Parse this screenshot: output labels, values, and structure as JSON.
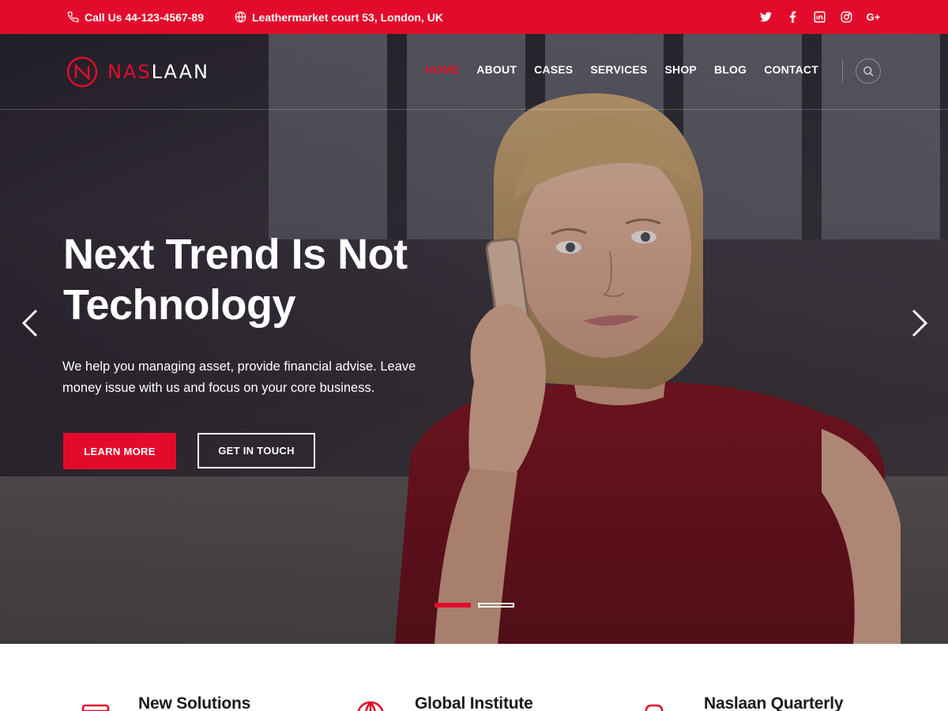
{
  "topbar": {
    "phone": "Call Us 44-123-4567-89",
    "address": "Leathermarket court 53, London, UK",
    "socials": [
      "twitter-icon",
      "facebook-icon",
      "linkedin-icon",
      "instagram-icon",
      "google-plus-icon"
    ],
    "gplus_label": "G+"
  },
  "header": {
    "logo_part1": "NAS",
    "logo_part2": "LAAN",
    "nav": [
      "HOME",
      "ABOUT",
      "CASES",
      "SERVICES",
      "SHOP",
      "BLOG",
      "CONTACT"
    ],
    "active_nav": "HOME"
  },
  "hero": {
    "headline_line1": "Next Trend Is Not",
    "headline_line2": "Technology",
    "subtext": "We help you managing asset, provide financial advise. Leave money issue with us and focus on your core business.",
    "primary_button": "LEARN MORE",
    "secondary_button": "GET IN TOUCH",
    "slides": 2,
    "active_slide": 1
  },
  "features": [
    {
      "title": "New Solutions",
      "icon": "card-icon"
    },
    {
      "title": "Global Institute",
      "icon": "globe-icon"
    },
    {
      "title": "Naslaan Quarterly",
      "icon": "chat-icon"
    }
  ],
  "colors": {
    "accent": "#e30b2c",
    "white": "#ffffff",
    "text_dark": "#1a1a1a"
  }
}
